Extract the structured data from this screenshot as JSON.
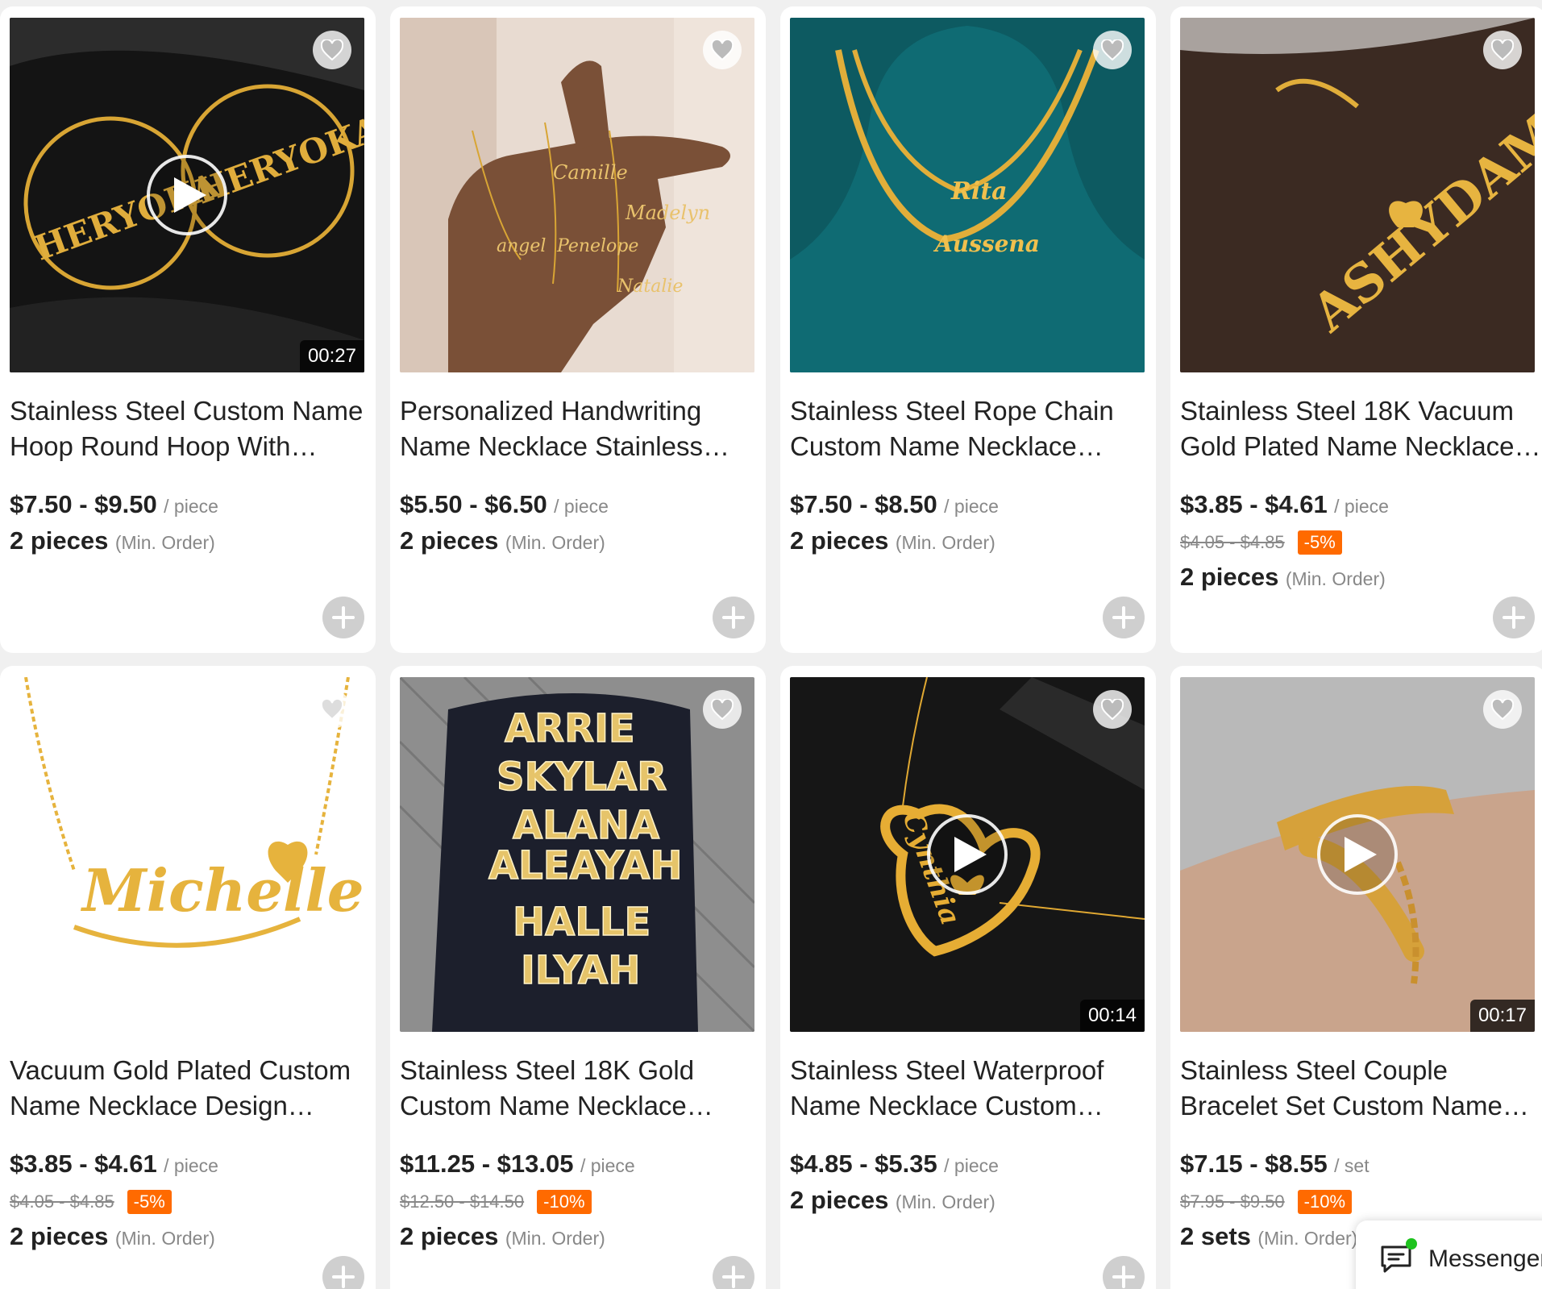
{
  "products": [
    {
      "title": "Stainless Steel Custom Name Hoop Round Hoop With Chain…",
      "price": "$7.50 - $9.50",
      "unit": "/ piece",
      "min_qty": "2 pieces",
      "min_label": "(Min. Order)",
      "video_duration": "00:27",
      "image_icon": "gold-name-hoop-earrings-image",
      "palette": [
        "#111111",
        "#3a3a3a",
        "#d8a534"
      ]
    },
    {
      "title": "Personalized Handwriting Name Necklace Stainless Ste…",
      "price": "$5.50 - $6.50",
      "unit": "/ piece",
      "min_qty": "2 pieces",
      "min_label": "(Min. Order)",
      "image_icon": "handwriting-name-necklaces-on-hand-image",
      "palette": [
        "#e9ddd4",
        "#7a5037",
        "#d8a534"
      ]
    },
    {
      "title": "Stainless Steel Rope Chain Custom Name Necklace…",
      "price": "$7.50 - $8.50",
      "unit": "/ piece",
      "min_qty": "2 pieces",
      "min_label": "(Min. Order)",
      "image_icon": "rope-chain-name-necklace-on-bust-image",
      "palette": [
        "#0f5f66",
        "#0a3d42",
        "#e1ae3a"
      ]
    },
    {
      "title": "Stainless Steel 18K Vacuum Gold Plated Name Necklace…",
      "price": "$3.85 - $4.61",
      "unit": "/ piece",
      "old_price": "$4.05 - $4.85",
      "discount": "-5%",
      "min_qty": "2 pieces",
      "min_label": "(Min. Order)",
      "image_icon": "name-necklace-on-dark-hand-image",
      "palette": [
        "#3b2a22",
        "#9a8a80",
        "#e0ad3a"
      ]
    },
    {
      "title": "Vacuum Gold Plated Custom Name Necklace Design…",
      "price": "$3.85 - $4.61",
      "unit": "/ piece",
      "old_price": "$4.05 - $4.85",
      "discount": "-5%",
      "min_qty": "2 pieces",
      "min_label": "(Min. Order)",
      "image_icon": "michelle-name-necklace-image",
      "palette": [
        "#ffffff",
        "#ffffff",
        "#e6b33d"
      ]
    },
    {
      "title": "Stainless Steel 18K Gold Custom Name Necklace Bling…",
      "price": "$11.25 - $13.05",
      "unit": "/ piece",
      "old_price": "$12.50 - $14.50",
      "discount": "-10%",
      "min_qty": "2 pieces",
      "min_label": "(Min. Order)",
      "image_icon": "bling-name-necklaces-on-glove-image",
      "palette": [
        "#8e8e8e",
        "#1c1f2c",
        "#e6c46a"
      ]
    },
    {
      "title": "Stainless Steel Waterproof Name Necklace Custom…",
      "price": "$4.85 - $5.35",
      "unit": "/ piece",
      "min_qty": "2 pieces",
      "min_label": "(Min. Order)",
      "video_duration": "00:14",
      "image_icon": "heart-butterfly-name-necklace-image",
      "palette": [
        "#111111",
        "#2a2a2a",
        "#e0a832"
      ]
    },
    {
      "title": "Stainless Steel Couple Bracelet Set Custom Name Souvenir…",
      "price": "$7.15 - $8.55",
      "unit": "/ set",
      "old_price": "$7.95 - $9.50",
      "discount": "-10%",
      "min_qty": "2 sets",
      "min_label": "(Min. Order)",
      "video_duration": "00:17",
      "image_icon": "couple-bracelets-on-wrist-image",
      "palette": [
        "#bcbcbc",
        "#c9a48c",
        "#d6a13a"
      ]
    }
  ],
  "messenger": {
    "label": "Messenger",
    "icon": "chat-icon",
    "status_color": "#1ec31e"
  },
  "colors": {
    "discount": "#ff6a00",
    "add_button": "#cfcfcf"
  }
}
